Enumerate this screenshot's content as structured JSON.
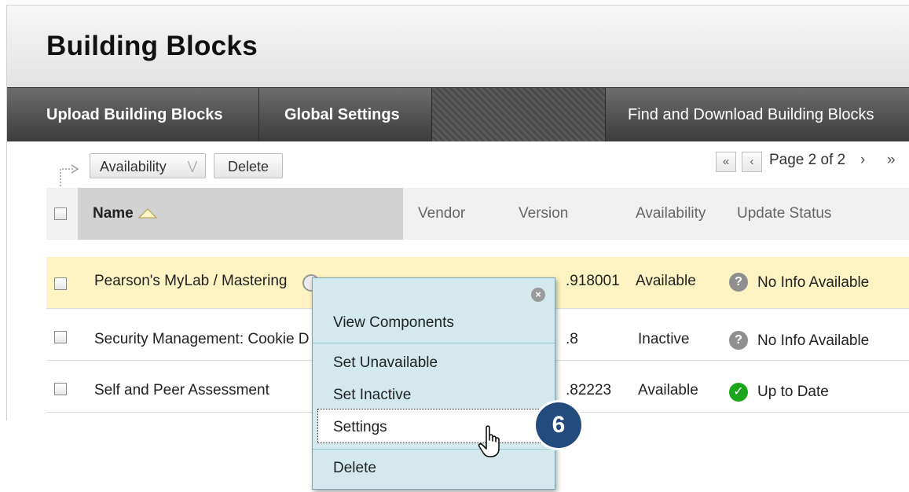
{
  "page": {
    "title": "Building Blocks"
  },
  "nav": {
    "tabs": [
      {
        "label": "Upload Building Blocks"
      },
      {
        "label": "Global Settings"
      },
      {
        "label": "Find and Download Building Blocks"
      }
    ]
  },
  "toolbar": {
    "availability_label": "Availability",
    "delete_label": "Delete"
  },
  "pager": {
    "label": "Page 2 of 2"
  },
  "table": {
    "columns": [
      "Name",
      "Vendor",
      "Version",
      "Availability",
      "Update Status"
    ],
    "rows": [
      {
        "name": "Pearson's MyLab / Mastering",
        "version": ".918001",
        "availability": "Available",
        "status": "No Info Available",
        "status_type": "unknown"
      },
      {
        "name": "Security Management: Cookie D",
        "version": ".8",
        "availability": "Inactive",
        "status": "No Info Available",
        "status_type": "unknown"
      },
      {
        "name": "Self and Peer Assessment",
        "version": ".82223",
        "availability": "Available",
        "status": "Up to Date",
        "status_type": "ok"
      }
    ]
  },
  "context_menu": {
    "items": [
      "View Components",
      "Set Unavailable",
      "Set Inactive",
      "Settings",
      "Delete"
    ]
  },
  "callout": {
    "step": "6"
  },
  "colors": {
    "highlight_row": "#fdf3c3",
    "menu_bg": "#d3e9ee",
    "badge": "#234b7c",
    "ok": "#1aa51a"
  }
}
